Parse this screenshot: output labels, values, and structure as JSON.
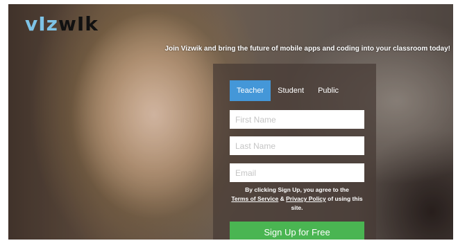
{
  "brand": {
    "logo_part1": "vIz",
    "logo_part2": "wIk"
  },
  "tagline": "Join Vizwik and bring the future of mobile apps and coding into your classroom today!",
  "tabs": [
    {
      "label": "Teacher",
      "active": true
    },
    {
      "label": "Student",
      "active": false
    },
    {
      "label": "Public",
      "active": false
    }
  ],
  "form": {
    "first_name_placeholder": "First Name",
    "last_name_placeholder": "Last Name",
    "email_placeholder": "Email",
    "legal_prefix": "By clicking Sign Up, you agree to the",
    "terms_link": "Terms of Service",
    "and_text": "&",
    "privacy_link": "Privacy Policy",
    "legal_suffix": "of using this site.",
    "submit_label": "Sign Up for Free"
  },
  "colors": {
    "active_tab": "#4497d8",
    "submit_button": "#4ab552",
    "logo_accent": "#7ec3e6"
  }
}
